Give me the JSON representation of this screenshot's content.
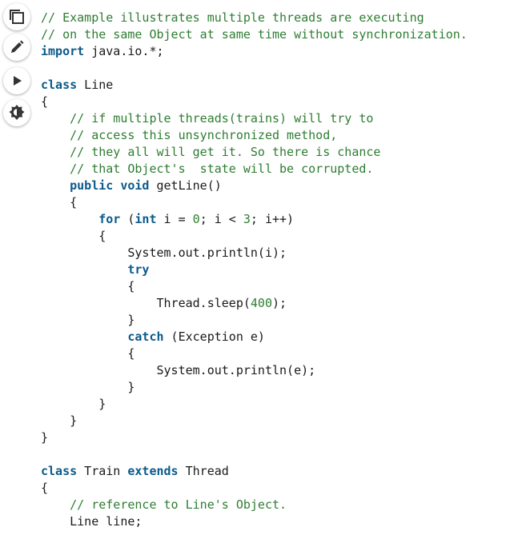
{
  "toolbar": {
    "buttons": [
      {
        "name": "copy-button",
        "icon": "copy-icon"
      },
      {
        "name": "edit-button",
        "icon": "pencil-icon"
      },
      {
        "name": "run-button",
        "icon": "play-icon"
      },
      {
        "name": "theme-toggle-button",
        "icon": "brightness-icon"
      }
    ]
  },
  "colors": {
    "comment": "#2e7d32",
    "keyword": "#0b5a8a",
    "number": "#2e7d32",
    "text": "#1a1a1a"
  },
  "code": {
    "language": "java",
    "lines": [
      [
        {
          "t": "comment",
          "v": "// Example illustrates multiple threads are executing"
        }
      ],
      [
        {
          "t": "comment",
          "v": "// on the same Object at same time without synchronization."
        }
      ],
      [
        {
          "t": "keyword",
          "v": "import"
        },
        {
          "t": "plain",
          "v": " java.io.*;"
        }
      ],
      [],
      [
        {
          "t": "keyword",
          "v": "class"
        },
        {
          "t": "plain",
          "v": " Line"
        }
      ],
      [
        {
          "t": "plain",
          "v": "{"
        }
      ],
      [
        {
          "t": "plain",
          "v": "    "
        },
        {
          "t": "comment",
          "v": "// if multiple threads(trains) will try to"
        }
      ],
      [
        {
          "t": "plain",
          "v": "    "
        },
        {
          "t": "comment",
          "v": "// access this unsynchronized method,"
        }
      ],
      [
        {
          "t": "plain",
          "v": "    "
        },
        {
          "t": "comment",
          "v": "// they all will get it. So there is chance"
        }
      ],
      [
        {
          "t": "plain",
          "v": "    "
        },
        {
          "t": "comment",
          "v": "// that Object's  state will be corrupted."
        }
      ],
      [
        {
          "t": "plain",
          "v": "    "
        },
        {
          "t": "keyword",
          "v": "public"
        },
        {
          "t": "plain",
          "v": " "
        },
        {
          "t": "keyword",
          "v": "void"
        },
        {
          "t": "plain",
          "v": " getLine()"
        }
      ],
      [
        {
          "t": "plain",
          "v": "    {"
        }
      ],
      [
        {
          "t": "plain",
          "v": "        "
        },
        {
          "t": "keyword",
          "v": "for"
        },
        {
          "t": "plain",
          "v": " ("
        },
        {
          "t": "keyword",
          "v": "int"
        },
        {
          "t": "plain",
          "v": " i = "
        },
        {
          "t": "number",
          "v": "0"
        },
        {
          "t": "plain",
          "v": "; i < "
        },
        {
          "t": "number",
          "v": "3"
        },
        {
          "t": "plain",
          "v": "; i++)"
        }
      ],
      [
        {
          "t": "plain",
          "v": "        {"
        }
      ],
      [
        {
          "t": "plain",
          "v": "            System.out.println(i);"
        }
      ],
      [
        {
          "t": "plain",
          "v": "            "
        },
        {
          "t": "keyword",
          "v": "try"
        }
      ],
      [
        {
          "t": "plain",
          "v": "            {"
        }
      ],
      [
        {
          "t": "plain",
          "v": "                Thread.sleep("
        },
        {
          "t": "number",
          "v": "400"
        },
        {
          "t": "plain",
          "v": ");"
        }
      ],
      [
        {
          "t": "plain",
          "v": "            }"
        }
      ],
      [
        {
          "t": "plain",
          "v": "            "
        },
        {
          "t": "keyword",
          "v": "catch"
        },
        {
          "t": "plain",
          "v": " (Exception e)"
        }
      ],
      [
        {
          "t": "plain",
          "v": "            {"
        }
      ],
      [
        {
          "t": "plain",
          "v": "                System.out.println(e);"
        }
      ],
      [
        {
          "t": "plain",
          "v": "            }"
        }
      ],
      [
        {
          "t": "plain",
          "v": "        }"
        }
      ],
      [
        {
          "t": "plain",
          "v": "    }"
        }
      ],
      [
        {
          "t": "plain",
          "v": "}"
        }
      ],
      [],
      [
        {
          "t": "keyword",
          "v": "class"
        },
        {
          "t": "plain",
          "v": " Train "
        },
        {
          "t": "keyword",
          "v": "extends"
        },
        {
          "t": "plain",
          "v": " Thread"
        }
      ],
      [
        {
          "t": "plain",
          "v": "{"
        }
      ],
      [
        {
          "t": "plain",
          "v": "    "
        },
        {
          "t": "comment",
          "v": "// reference to Line's Object."
        }
      ],
      [
        {
          "t": "plain",
          "v": "    Line line;"
        }
      ]
    ]
  }
}
